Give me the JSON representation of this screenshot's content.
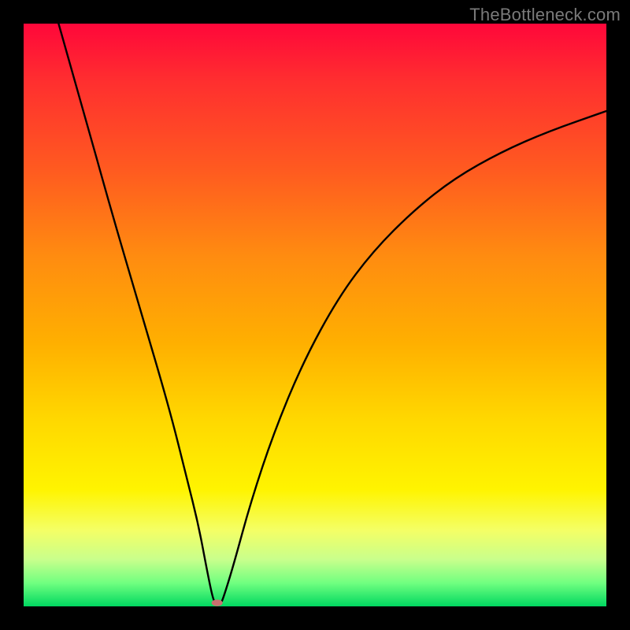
{
  "watermark": "TheBottleneck.com",
  "chart_data": {
    "type": "line",
    "title": "",
    "xlabel": "",
    "ylabel": "",
    "xlim": [
      0,
      100
    ],
    "ylim": [
      0,
      100
    ],
    "grid": false,
    "curve_points": [
      {
        "x": 6,
        "y": 100
      },
      {
        "x": 10,
        "y": 86
      },
      {
        "x": 15,
        "y": 68
      },
      {
        "x": 20,
        "y": 51
      },
      {
        "x": 25,
        "y": 34
      },
      {
        "x": 28,
        "y": 22
      },
      {
        "x": 30,
        "y": 14
      },
      {
        "x": 31.5,
        "y": 6
      },
      {
        "x": 32.5,
        "y": 1.2
      },
      {
        "x": 33,
        "y": 0.5
      },
      {
        "x": 33.8,
        "y": 0.5
      },
      {
        "x": 34.2,
        "y": 1.2
      },
      {
        "x": 36,
        "y": 7
      },
      {
        "x": 39,
        "y": 18
      },
      {
        "x": 43,
        "y": 30
      },
      {
        "x": 48,
        "y": 42
      },
      {
        "x": 54,
        "y": 53
      },
      {
        "x": 60,
        "y": 61
      },
      {
        "x": 67,
        "y": 68
      },
      {
        "x": 74,
        "y": 73.5
      },
      {
        "x": 82,
        "y": 78
      },
      {
        "x": 90,
        "y": 81.5
      },
      {
        "x": 100,
        "y": 85
      }
    ],
    "marker": {
      "x": 33.2,
      "y": 0.6,
      "color": "#c97070"
    },
    "background_gradient": {
      "top": "#ff073a",
      "bottom": "#00d860"
    }
  }
}
